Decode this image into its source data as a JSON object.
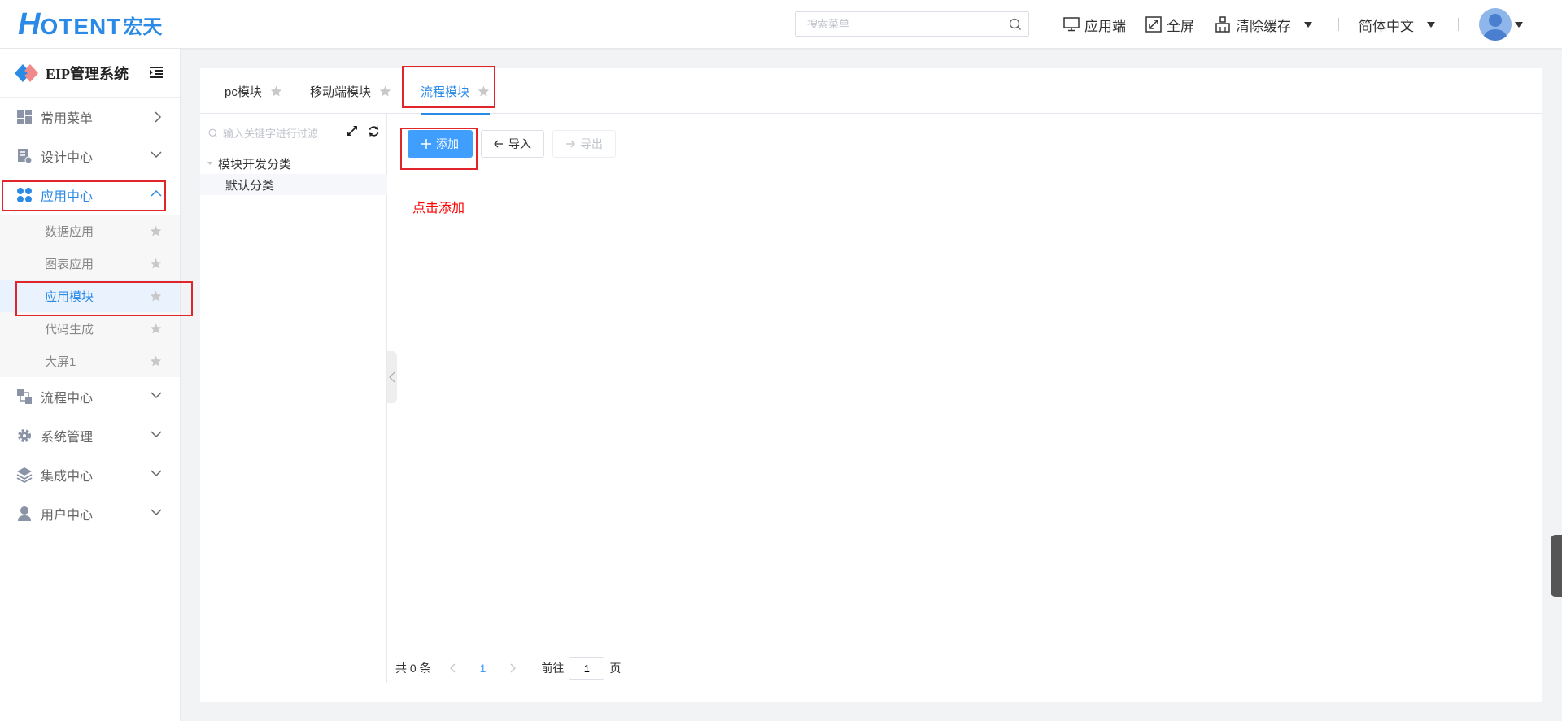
{
  "header": {
    "logo_h": "H",
    "logo_rest": "OTENT",
    "logo_cn": "宏天",
    "search_placeholder": "搜索菜单",
    "app_end": "应用端",
    "fullscreen": "全屏",
    "clear_cache": "清除缓存",
    "language": "简体中文"
  },
  "sidebar": {
    "brand": "EIP管理系统",
    "menus": [
      {
        "label": "常用菜单",
        "icon": "dashboard-icon"
      },
      {
        "label": "设计中心",
        "icon": "design-doc-icon"
      },
      {
        "label": "应用中心",
        "icon": "app-grid-icon",
        "active": true
      },
      {
        "label": "流程中心",
        "icon": "flow-icon"
      },
      {
        "label": "系统管理",
        "icon": "gear-icon"
      },
      {
        "label": "集成中心",
        "icon": "layers-icon"
      },
      {
        "label": "用户中心",
        "icon": "user-icon"
      }
    ],
    "app_center_sub": [
      "数据应用",
      "图表应用",
      "应用模块",
      "代码生成",
      "大屏1"
    ]
  },
  "tabs": [
    "pc模块",
    "移动端模块",
    "流程模块"
  ],
  "tree": {
    "filter_placeholder": "输入关键字进行过滤",
    "root": "模块开发分类",
    "child": "默认分类"
  },
  "toolbar": {
    "add": "添加",
    "import": "导入",
    "export": "导出"
  },
  "hint": "点击添加",
  "pager": {
    "total": "共 0 条",
    "current": "1",
    "goto": "前往",
    "page_value": "1",
    "page_unit": "页"
  },
  "colors": {
    "primary": "#409eff",
    "brand": "#2b8ae6",
    "highlight": "#e0262b"
  }
}
